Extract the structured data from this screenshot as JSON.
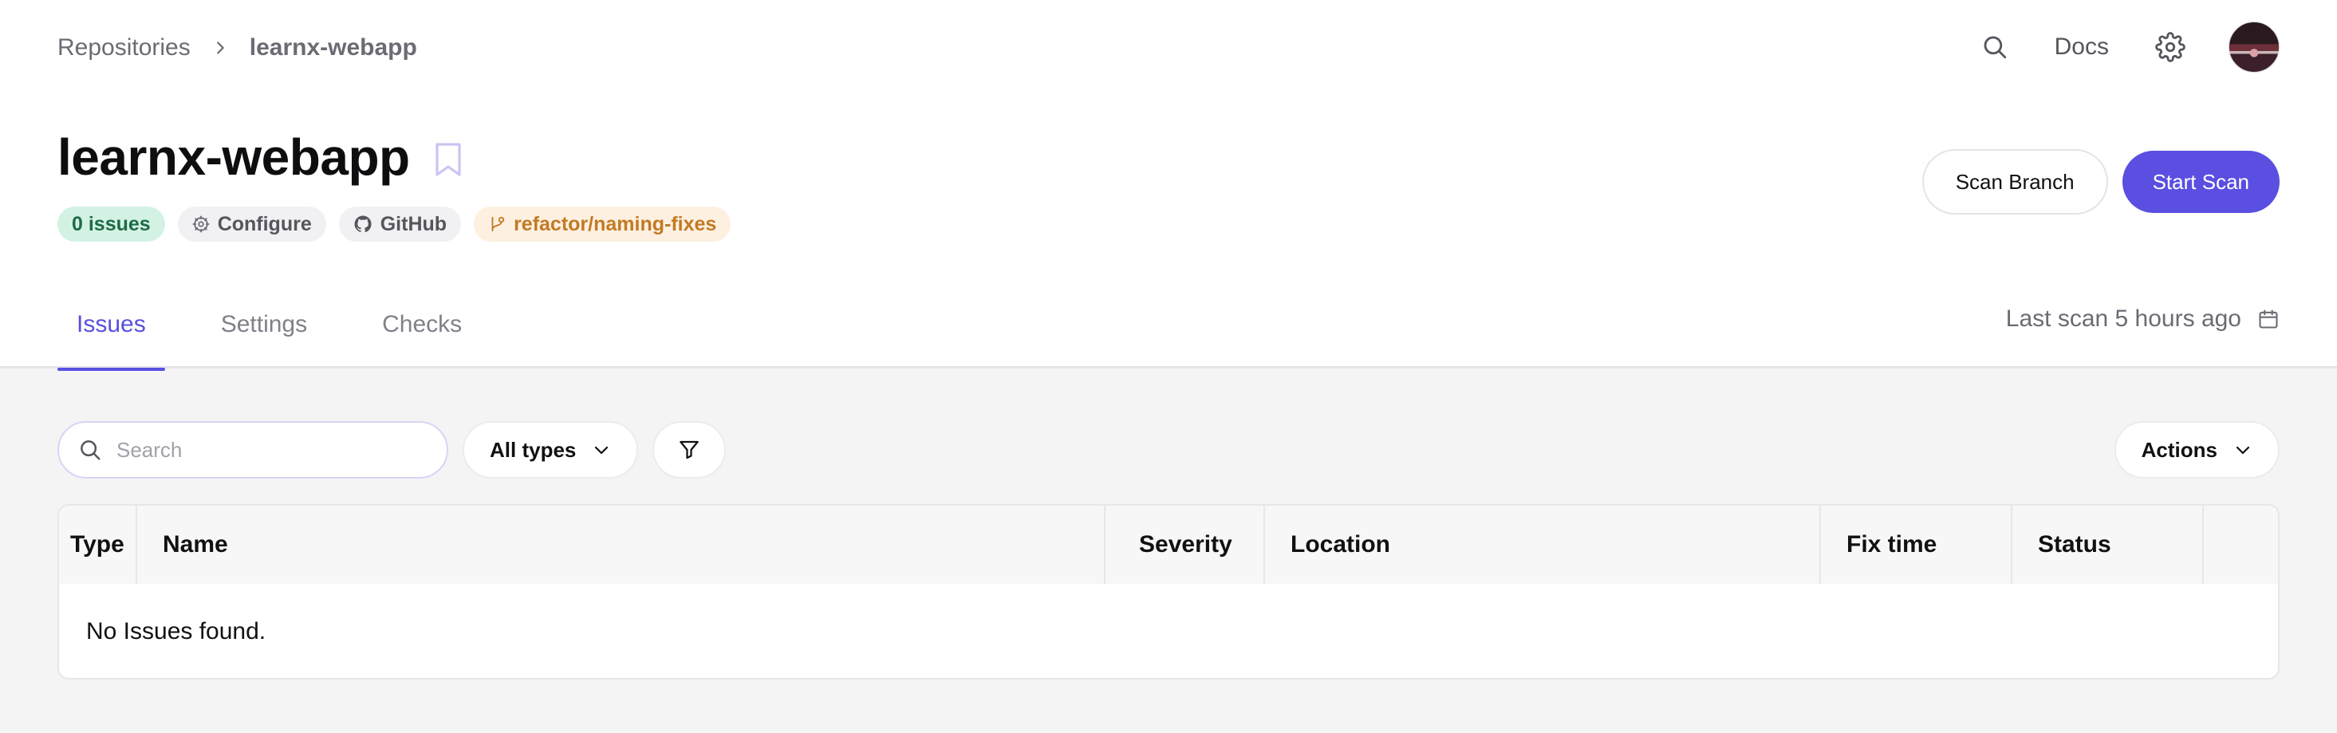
{
  "breadcrumb": {
    "root": "Repositories",
    "current": "learnx-webapp"
  },
  "topbar": {
    "docs_label": "Docs",
    "icons": [
      "search-icon",
      "gear-icon",
      "avatar"
    ]
  },
  "repo": {
    "title": "learnx-webapp",
    "chips": {
      "issues": "0 issues",
      "configure": "Configure",
      "github": "GitHub",
      "branch": "refactor/naming-fixes"
    }
  },
  "buttons": {
    "scan_branch": "Scan Branch",
    "start_scan": "Start Scan"
  },
  "tabs": [
    {
      "label": "Issues",
      "active": true
    },
    {
      "label": "Settings",
      "active": false
    },
    {
      "label": "Checks",
      "active": false
    }
  ],
  "last_scan": "Last scan 5 hours ago",
  "toolbar": {
    "search_placeholder": "Search",
    "type_filter": "All types",
    "actions_label": "Actions"
  },
  "table": {
    "columns": [
      "Type",
      "Name",
      "Severity",
      "Location",
      "Fix time",
      "Status",
      ""
    ],
    "empty_message": "No Issues found."
  },
  "colors": {
    "accent": "#5a4fe0",
    "issues_chip_bg": "#d3f2e3",
    "issues_chip_text": "#1d6b47",
    "branch_chip_bg": "#fdf0e1",
    "branch_chip_text": "#c27a24"
  }
}
